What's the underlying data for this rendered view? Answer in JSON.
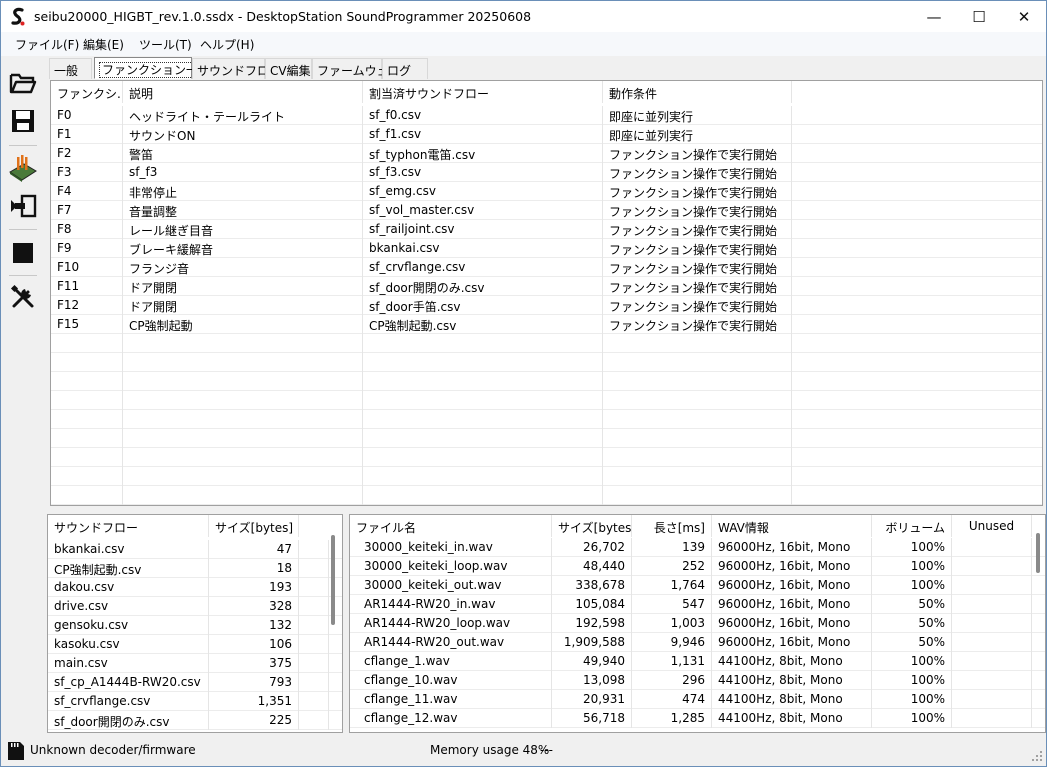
{
  "window": {
    "title": "seibu20000_HIGBT_rev.1.0.ssdx - DesktopStation SoundProgrammer 20250608",
    "minimize": "—",
    "maximize": "☐",
    "close": "✕"
  },
  "menu": [
    "ファイル(F)",
    "編集(E)",
    "ツール(T)",
    "ヘルプ(H)"
  ],
  "tabs": [
    "一般",
    "ファンクション一覧",
    "サウンドフロー",
    "CV編集",
    "ファームウェア",
    "ログ"
  ],
  "function_table": {
    "headers": [
      "ファンクシ...",
      "説明",
      "割当済サウンドフロー",
      "動作条件"
    ],
    "rows": [
      [
        "F0",
        "ヘッドライト・テールライト",
        "sf_f0.csv",
        "即座に並列実行"
      ],
      [
        "F1",
        "サウンドON",
        "sf_f1.csv",
        "即座に並列実行"
      ],
      [
        "F2",
        "警笛",
        "sf_typhon電笛.csv",
        "ファンクション操作で実行開始"
      ],
      [
        "F3",
        "sf_f3",
        "sf_f3.csv",
        "ファンクション操作で実行開始"
      ],
      [
        "F4",
        "非常停止",
        "sf_emg.csv",
        "ファンクション操作で実行開始"
      ],
      [
        "F7",
        "音量調整",
        "sf_vol_master.csv",
        "ファンクション操作で実行開始"
      ],
      [
        "F8",
        "レール継ぎ目音",
        "sf_railjoint.csv",
        "ファンクション操作で実行開始"
      ],
      [
        "F9",
        "ブレーキ緩解音",
        "bkankai.csv",
        "ファンクション操作で実行開始"
      ],
      [
        "F10",
        "フランジ音",
        "sf_crvflange.csv",
        "ファンクション操作で実行開始"
      ],
      [
        "F11",
        "ドア開閉",
        "sf_door開閉のみ.csv",
        "ファンクション操作で実行開始"
      ],
      [
        "F12",
        "ドア開閉",
        "sf_door手笛.csv",
        "ファンクション操作で実行開始"
      ],
      [
        "F15",
        "CP強制起動",
        "CP強制起動.csv",
        "ファンクション操作で実行開始"
      ]
    ]
  },
  "soundflow_table": {
    "headers": [
      "サウンドフロー",
      "サイズ[bytes]"
    ],
    "rows": [
      [
        "bkankai.csv",
        "47"
      ],
      [
        "CP強制起動.csv",
        "18"
      ],
      [
        "dakou.csv",
        "193"
      ],
      [
        "drive.csv",
        "328"
      ],
      [
        "gensoku.csv",
        "132"
      ],
      [
        "kasoku.csv",
        "106"
      ],
      [
        "main.csv",
        "375"
      ],
      [
        "sf_cp_A1444B-RW20.csv",
        "793"
      ],
      [
        "sf_crvflange.csv",
        "1,351"
      ],
      [
        "sf_door開閉のみ.csv",
        "225"
      ]
    ]
  },
  "wav_table": {
    "headers": [
      "ファイル名",
      "サイズ[bytes]",
      "長さ[ms]",
      "WAV情報",
      "ボリューム",
      "Unused"
    ],
    "rows": [
      [
        "30000_keiteki_in.wav",
        "26,702",
        "139",
        "96000Hz, 16bit, Mono",
        "100%",
        ""
      ],
      [
        "30000_keiteki_loop.wav",
        "48,440",
        "252",
        "96000Hz, 16bit, Mono",
        "100%",
        ""
      ],
      [
        "30000_keiteki_out.wav",
        "338,678",
        "1,764",
        "96000Hz, 16bit, Mono",
        "100%",
        ""
      ],
      [
        "AR1444-RW20_in.wav",
        "105,084",
        "547",
        "96000Hz, 16bit, Mono",
        "50%",
        ""
      ],
      [
        "AR1444-RW20_loop.wav",
        "192,598",
        "1,003",
        "96000Hz, 16bit, Mono",
        "50%",
        ""
      ],
      [
        "AR1444-RW20_out.wav",
        "1,909,588",
        "9,946",
        "96000Hz, 16bit, Mono",
        "50%",
        ""
      ],
      [
        "cflange_1.wav",
        "49,940",
        "1,131",
        "44100Hz, 8bit, Mono",
        "100%",
        ""
      ],
      [
        "cflange_10.wav",
        "13,098",
        "296",
        "44100Hz, 8bit, Mono",
        "100%",
        ""
      ],
      [
        "cflange_11.wav",
        "20,931",
        "474",
        "44100Hz, 8bit, Mono",
        "100%",
        ""
      ],
      [
        "cflange_12.wav",
        "56,718",
        "1,285",
        "44100Hz, 8bit, Mono",
        "100%",
        ""
      ]
    ]
  },
  "status": {
    "decoder": "Unknown decoder/firmware",
    "memory": "Memory usage 48%",
    "extra": "---"
  }
}
